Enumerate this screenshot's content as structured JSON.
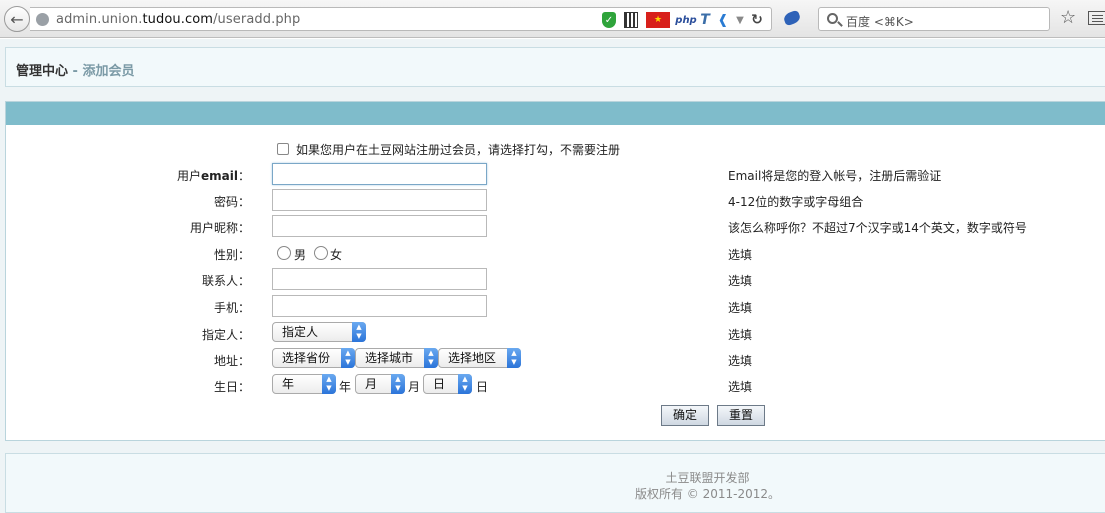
{
  "browser": {
    "url_prefix": "admin.union.",
    "url_domain": "tudou.com",
    "url_path": "/useradd.php",
    "search_placeholder": "百度 <⌘K>",
    "icons": [
      "back-icon",
      "globe-icon",
      "shield-icon",
      "qr-icon",
      "flag-icon",
      "php-icon",
      "t-icon",
      "wifi-icon",
      "dropdown-icon",
      "reload-icon",
      "bird-icon",
      "search-icon",
      "star-icon",
      "menu-icon"
    ]
  },
  "header": {
    "title": "管理中心",
    "subtitle": " - 添加会员"
  },
  "form": {
    "checkbox_label": "如果您用户在土豆网站注册过会员，请选择打勾，不需要注册",
    "email": {
      "label_cn": "用户",
      "label_en": "email",
      "colon": "：",
      "hint": "Email将是您的登入帐号，注册后需验证"
    },
    "password": {
      "label": "密码：",
      "hint": "4-12位的数字或字母组合"
    },
    "nickname": {
      "label": "用户昵称：",
      "hint": "该怎么称呼你？不超过7个汉字或14个英文，数字或符号"
    },
    "gender": {
      "label": "性别：",
      "male": "男",
      "female": "女",
      "hint": "选填"
    },
    "contact": {
      "label": "联系人：",
      "hint": "选填"
    },
    "mobile": {
      "label": "手机：",
      "hint": "选填"
    },
    "assignee": {
      "label": "指定人：",
      "selected": "指定人",
      "hint": "选填"
    },
    "address": {
      "label": "地址：",
      "province": "选择省份",
      "city": "选择城市",
      "district": "选择地区",
      "hint": "选填"
    },
    "birthday": {
      "label": "生日：",
      "year": "年",
      "year_unit": "年",
      "month": "月",
      "month_unit": "月",
      "day": "日",
      "day_unit": "日",
      "hint": "选填"
    },
    "submit_label": "确定",
    "reset_label": "重置"
  },
  "footer": {
    "line1": "土豆联盟开发部",
    "line2": "版权所有 © 2011-2012。"
  }
}
